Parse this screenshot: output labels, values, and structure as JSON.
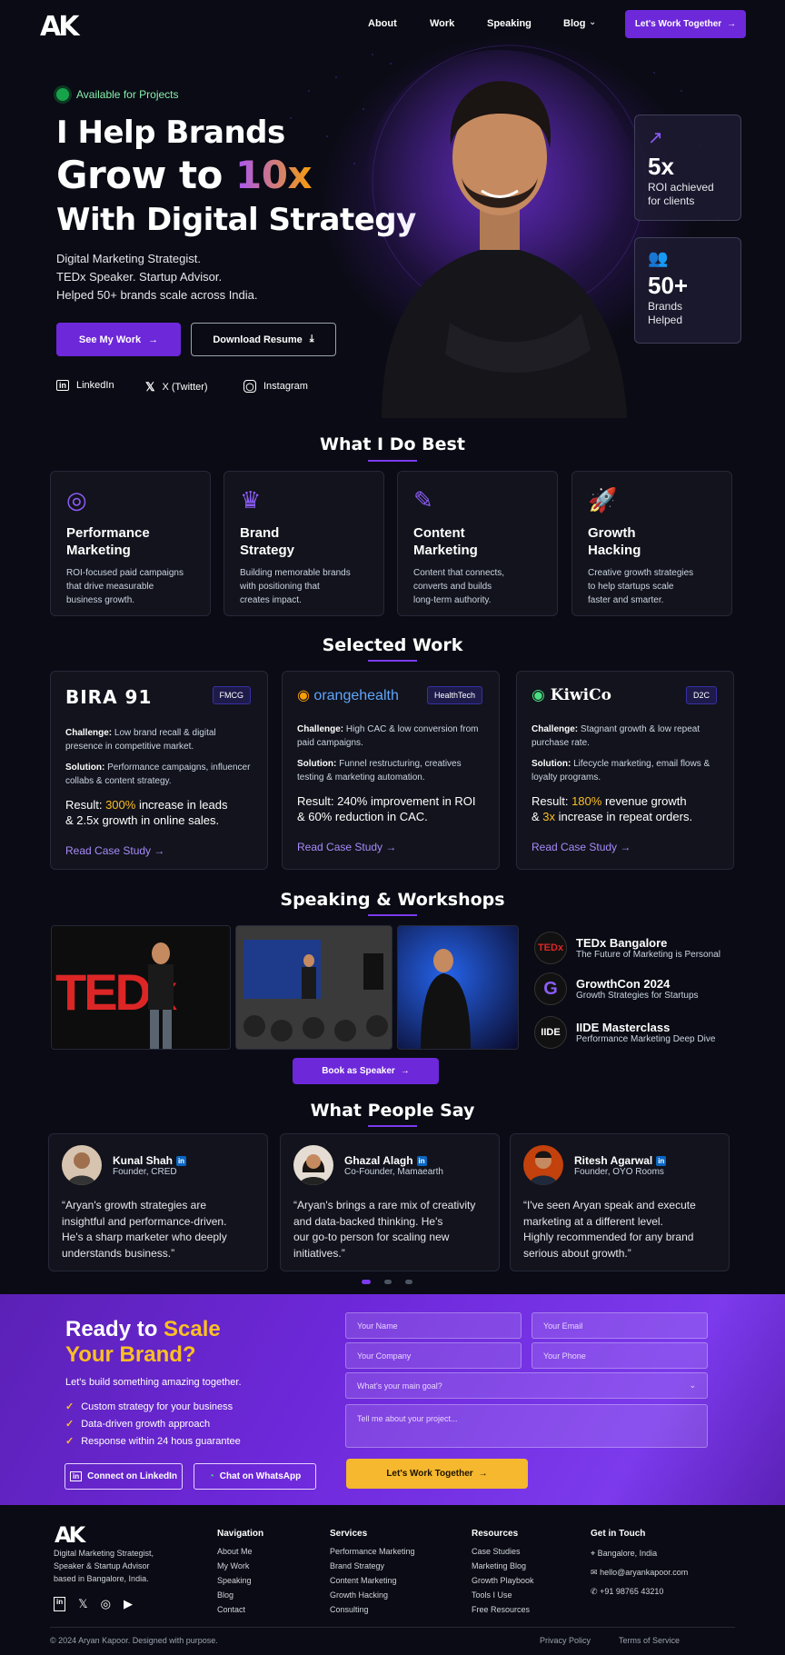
{
  "nav": {
    "logo": "AK",
    "links": [
      "About",
      "Work",
      "Speaking",
      "Blog"
    ],
    "cta": "Let's Work Together"
  },
  "hero": {
    "available": "Available for Projects",
    "line1": "I Help Brands",
    "line2a": "Grow to ",
    "line2b": "10x",
    "line3": "With Digital Strategy",
    "sub": [
      "Digital Marketing Strategist.",
      "TEDx Speaker. Startup Advisor.",
      "Helped 50+ brands scale across India."
    ],
    "btn_primary": "See My Work",
    "btn_secondary": "Download Resume",
    "socials": [
      "LinkedIn",
      "X (Twitter)",
      "Instagram"
    ],
    "stats": [
      {
        "value": "5x",
        "label1": "ROI achieved",
        "label2": "for clients"
      },
      {
        "value": "50+",
        "label1": "Brands",
        "label2": "Helped"
      }
    ]
  },
  "services": {
    "title": "What I Do Best",
    "items": [
      {
        "icon": "target-icon",
        "t1": "Performance",
        "t2": "Marketing",
        "d": [
          "ROI-focused paid campaigns",
          "that drive measurable",
          "business growth."
        ]
      },
      {
        "icon": "crown-icon",
        "t1": "Brand",
        "t2": "Strategy",
        "d": [
          "Building memorable brands",
          "with positioning that",
          "creates impact."
        ]
      },
      {
        "icon": "pencil-icon",
        "t1": "Content",
        "t2": "Marketing",
        "d": [
          "Content that connects,",
          "converts and builds",
          "long-term authority."
        ]
      },
      {
        "icon": "rocket-icon",
        "t1": "Growth",
        "t2": "Hacking",
        "d": [
          "Creative growth strategies",
          "to help startups scale",
          "faster and smarter."
        ]
      }
    ]
  },
  "work": {
    "title": "Selected Work",
    "items": [
      {
        "brand": "BIRA 91",
        "tag": "FMCG",
        "challenge_label": "Challenge:",
        "challenge": " Low brand recall & digital presence in competitive market.",
        "solution_label": "Solution:",
        "solution": " Performance campaigns, influencer collabs & content strategy.",
        "result_label": "Result: ",
        "hl1": "300%",
        "r1": " increase in leads",
        "r2": "& 2.5x growth in online sales.",
        "link": "Read Case Study"
      },
      {
        "brand": "orangehealth",
        "tag": "HealthTech",
        "challenge_label": "Challenge:",
        "challenge": " High CAC & low conversion from paid campaigns.",
        "solution_label": "Solution:",
        "solution": " Funnel restructuring, creatives testing & marketing automation.",
        "result_label": "Result: ",
        "hl1": "240%",
        "r1": " improvement in ROI",
        "r2": "& 60% reduction in CAC.",
        "link": "Read Case Study"
      },
      {
        "brand": "KiwiCo",
        "tag": "D2C",
        "challenge_label": "Challenge:",
        "challenge": " Stagnant growth & low repeat purchase rate.",
        "solution_label": "Solution:",
        "solution": " Lifecycle marketing, email flows & loyalty programs.",
        "result_label": "Result: ",
        "hl1": "180%",
        "r1": " revenue growth",
        "hl2": "3x",
        "r2b": " increase in repeat orders.",
        "link": "Read Case Study"
      }
    ]
  },
  "speaking": {
    "title": "Speaking & Workshops",
    "tedx_text": "TEDx",
    "events": [
      {
        "badge": "TEDx",
        "title": "TEDx Bangalore",
        "sub": "The Future of Marketing is Personal"
      },
      {
        "badge": "G",
        "title": "GrowthCon 2024",
        "sub": "Growth Strategies for Startups"
      },
      {
        "badge": "IIDE",
        "title": "IIDE Masterclass",
        "sub": "Performance Marketing Deep Dive"
      }
    ],
    "cta": "Book as Speaker"
  },
  "testimonials": {
    "title": "What People Say",
    "li": "in",
    "items": [
      {
        "name": "Kunal Shah",
        "role": "Founder, CRED",
        "q": [
          "“Aryan's growth strategies are",
          "insightful and performance-driven.",
          "He's a sharp marketer who deeply",
          "understands business.”"
        ]
      },
      {
        "name": "Ghazal Alagh",
        "role": "Co-Founder, Mamaearth",
        "q": [
          "“Aryan's brings a rare mix of creativity",
          "and data-backed thinking. He's",
          "our go-to person for scaling new",
          "initiatives.”"
        ]
      },
      {
        "name": "Ritesh Agarwal",
        "role": "Founder, OYO Rooms",
        "q": [
          "“I've seen Aryan speak and execute",
          "marketing at a different level.",
          "Highly recommended for any brand",
          "serious about growth.”"
        ]
      }
    ]
  },
  "cta": {
    "h_a": "Ready to ",
    "h_b": "Scale",
    "h_c": "Your Brand?",
    "sub": "Let's build something amazing together.",
    "checks": [
      "Custom strategy for your business",
      "Data-driven growth approach",
      "Response within 24 hous guarantee"
    ],
    "btn_li": "Connect on LinkedIn",
    "btn_wa": "Chat on WhatsApp",
    "f_name": "Your Name",
    "f_email": "Your Email",
    "f_company": "Your Company",
    "f_phone": "Your Phone",
    "f_goal": "What's your main goal?",
    "f_msg": "Tell me about your project...",
    "submit": "Let's Work Together"
  },
  "footer": {
    "logo": "AK",
    "about": [
      "Digital Marketing Strategist,",
      "Speaker & Startup Advisor",
      "based in Bangalore, India."
    ],
    "cols": [
      {
        "h": "Navigation",
        "items": [
          "About Me",
          "My Work",
          "Speaking",
          "Blog",
          "Contact"
        ]
      },
      {
        "h": "Services",
        "items": [
          "Performance Marketing",
          "Brand Strategy",
          "Content Marketing",
          "Growth Hacking",
          "Consulting"
        ]
      },
      {
        "h": "Resources",
        "items": [
          "Case Studies",
          "Marketing Blog",
          "Growth Playbook",
          "Tools I Use",
          "Free Resources"
        ]
      }
    ],
    "contact_h": "Get in Touch",
    "contact": [
      "Bangalore, India",
      "hello@aryankapoor.com",
      "+91 98765 43210"
    ],
    "copy": "© 2024 Aryan Kapoor. Designed with purpose.",
    "privacy": "Privacy Policy",
    "terms": "Terms of Service"
  }
}
